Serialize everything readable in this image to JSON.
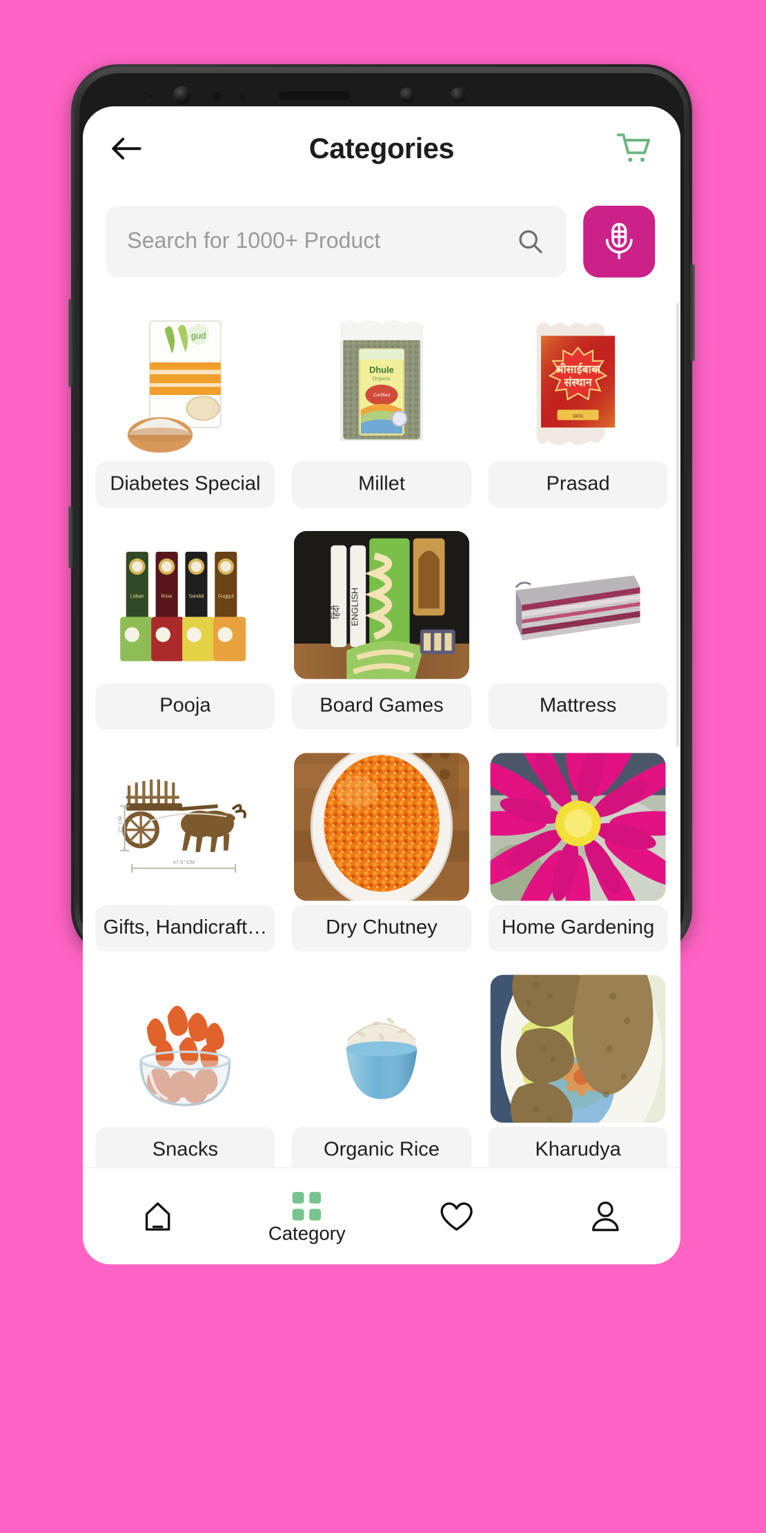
{
  "theme": {
    "background": "#FF63C4",
    "accent_magenta": "#CB2188",
    "cart_green": "#6DB67F",
    "category_green": "#77C48E",
    "label_bg": "#F4F4F4",
    "search_bg": "#F4F4F4"
  },
  "header": {
    "title": "Categories",
    "back_icon": "arrow-left-icon",
    "cart_icon": "shopping-cart-icon"
  },
  "search": {
    "placeholder": "Search for 1000+ Product",
    "value": "",
    "search_icon": "magnifier-icon",
    "mic_icon": "microphone-icon"
  },
  "categories": [
    {
      "label": "Diabetes Special",
      "art": "jowar-flakes-box",
      "framed": false
    },
    {
      "label": "Millet",
      "art": "millet-packet",
      "framed": false
    },
    {
      "label": "Prasad",
      "art": "prasad-packet",
      "framed": false
    },
    {
      "label": "Pooja",
      "art": "incense-boxes",
      "framed": false
    },
    {
      "label": "Board Games",
      "art": "board-game-set",
      "framed": true
    },
    {
      "label": "Mattress",
      "art": "folded-mattress",
      "framed": false
    },
    {
      "label": "Gifts, Handicraft…",
      "art": "bullock-cart",
      "framed": false
    },
    {
      "label": "Dry Chutney",
      "art": "chutney-bowl",
      "framed": true
    },
    {
      "label": "Home Gardening",
      "art": "pink-lotus",
      "framed": true
    },
    {
      "label": "Snacks",
      "art": "snack-bowl",
      "framed": false
    },
    {
      "label": "Organic Rice",
      "art": "rice-bowl",
      "framed": false
    },
    {
      "label": "Kharudya",
      "art": "kharudya-plate",
      "framed": true
    }
  ],
  "bottom_nav": [
    {
      "label": "",
      "icon": "home-icon",
      "active": false
    },
    {
      "label": "Category",
      "icon": "grid-icon",
      "active": true
    },
    {
      "label": "",
      "icon": "heart-icon",
      "active": false
    },
    {
      "label": "",
      "icon": "person-icon",
      "active": false
    }
  ]
}
